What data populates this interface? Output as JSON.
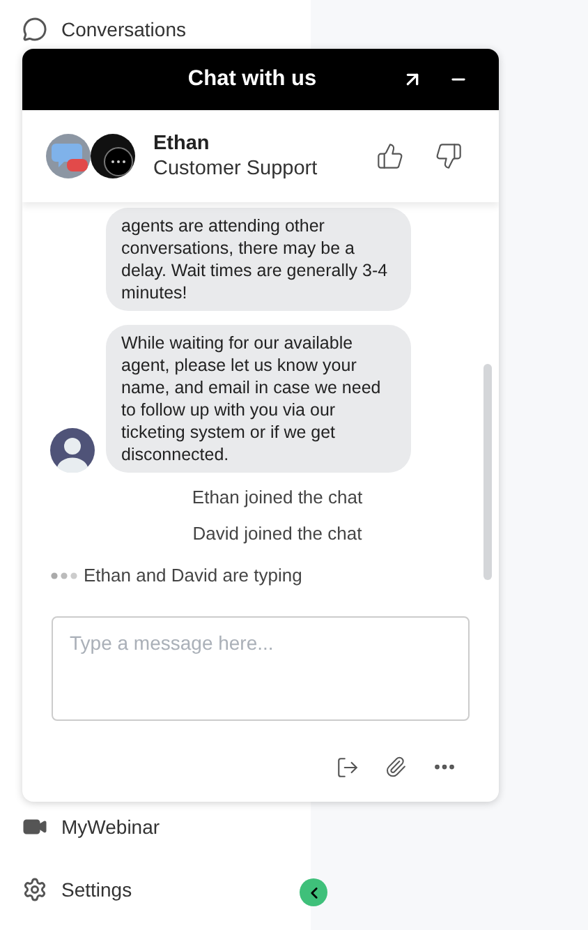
{
  "sidebar": {
    "items": [
      {
        "kind": "chat",
        "label": "Conversations"
      },
      {
        "kind": "video",
        "label": "MyWebinar"
      },
      {
        "kind": "settings",
        "label": "Settings"
      }
    ]
  },
  "chat": {
    "title": "Chat with us",
    "agent": {
      "name": "Ethan",
      "role": "Customer Support"
    },
    "messages": [
      {
        "kind": "bubble",
        "text": "agents are attending other conversations, there may be a delay. Wait times are generally 3-4 minutes!",
        "avatar": false
      },
      {
        "kind": "bubble",
        "text": "While waiting for our available agent, please let us know your name, and email in case we need to follow up with you via our ticketing system or if we get disconnected.",
        "avatar": true
      },
      {
        "kind": "event",
        "text": "Ethan joined the chat"
      },
      {
        "kind": "event",
        "text": "David joined the chat"
      },
      {
        "kind": "typing",
        "text": "Ethan and David are typing"
      }
    ],
    "input": {
      "placeholder": "Type a message here..."
    }
  }
}
